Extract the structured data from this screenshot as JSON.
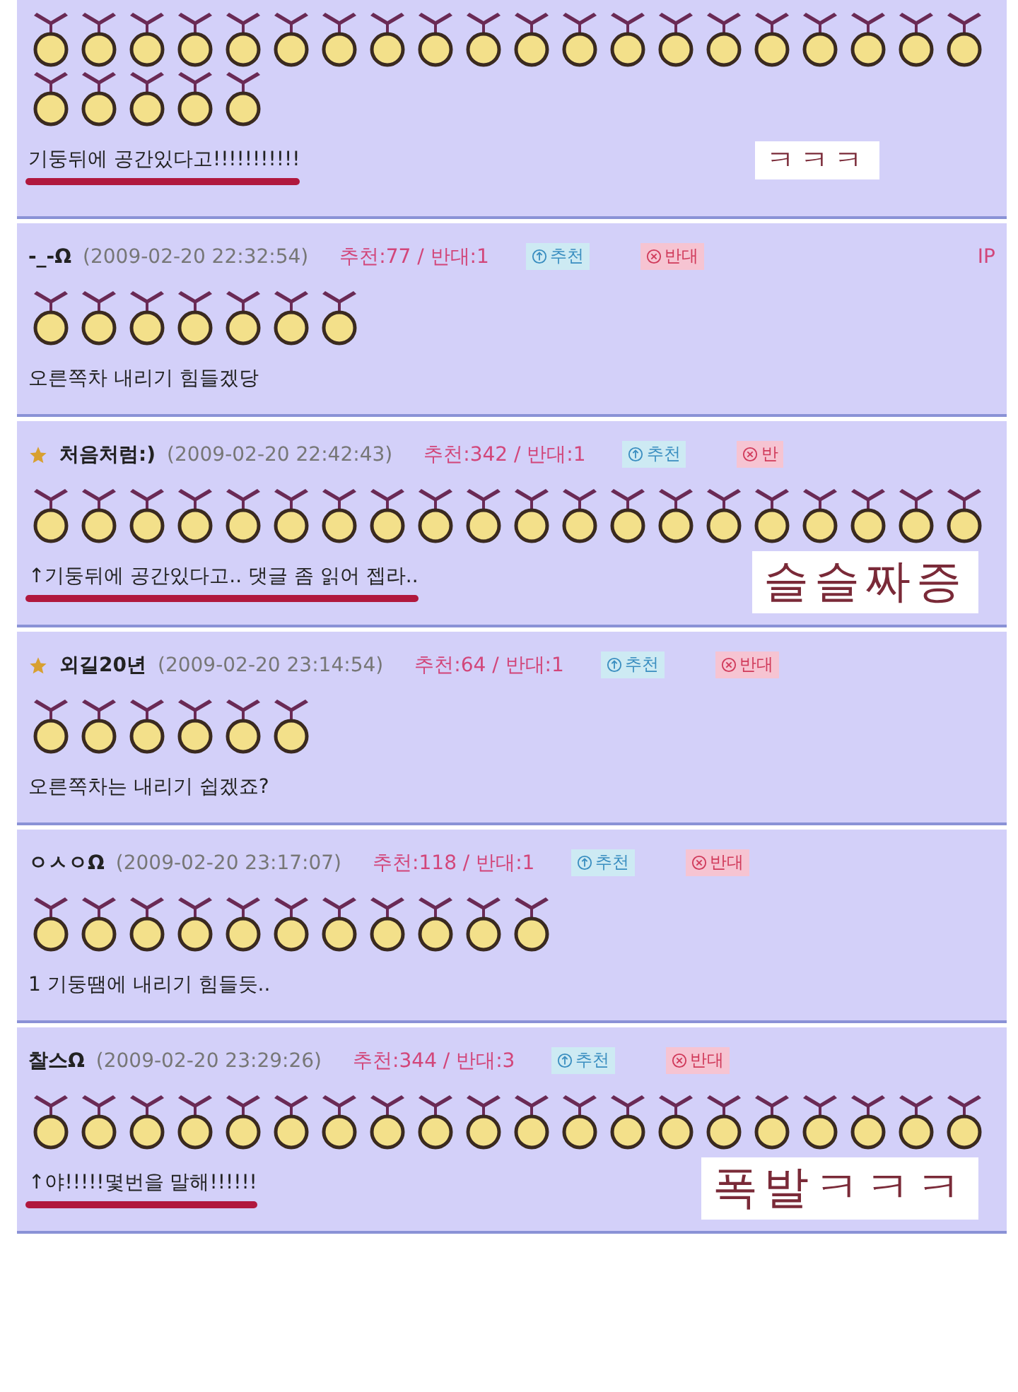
{
  "comments": [
    {
      "medals": [
        {
          "kind": "medal"
        },
        {
          "kind": "medal"
        },
        {
          "kind": "medal"
        },
        {
          "kind": "medal"
        },
        {
          "kind": "medal"
        },
        {
          "kind": "medal"
        },
        {
          "kind": "medal"
        },
        {
          "kind": "medal"
        },
        {
          "kind": "medal"
        },
        {
          "kind": "medal"
        },
        {
          "kind": "medal"
        },
        {
          "kind": "medal"
        },
        {
          "kind": "medal"
        },
        {
          "kind": "medal"
        },
        {
          "kind": "medal"
        },
        {
          "kind": "medal"
        },
        {
          "kind": "medal"
        },
        {
          "kind": "medal"
        },
        {
          "kind": "medal"
        },
        {
          "kind": "medal"
        },
        {
          "kind": "medal"
        },
        {
          "kind": "medal"
        },
        {
          "kind": "medal"
        },
        {
          "kind": "medal"
        },
        {
          "kind": "medal"
        }
      ],
      "text": "기둥뒤에 공간있다고!!!!!!!!!!!",
      "underlined": true,
      "caption": "ㅋㅋㅋ"
    },
    {
      "author": "-_-Ω",
      "starred": false,
      "date": "(2009-02-20 22:32:54)",
      "votes": "추천:77 / 반대:1",
      "buttons": [
        {
          "kind": "recommend",
          "label": "추천"
        },
        {
          "kind": "oppose",
          "label": "반대"
        }
      ],
      "ip": "IP",
      "medals": [
        {
          "kind": "medal"
        },
        {
          "kind": "medal"
        },
        {
          "kind": "medal"
        },
        {
          "kind": "medal"
        },
        {
          "kind": "medal"
        },
        {
          "kind": "medal"
        },
        {
          "kind": "medal"
        }
      ],
      "text": "오른쪽차 내리기 힘들겠당",
      "underlined": false
    },
    {
      "author": "처음처럼:)",
      "starred": true,
      "date": "(2009-02-20 22:42:43)",
      "votes": "추천:342 / 반대:1",
      "buttons": [
        {
          "kind": "recommend",
          "label": "추천"
        },
        {
          "kind": "oppose",
          "label": "반"
        }
      ],
      "medals": [
        {
          "kind": "medal"
        },
        {
          "kind": "medal"
        },
        {
          "kind": "medal"
        },
        {
          "kind": "medal"
        },
        {
          "kind": "medal"
        },
        {
          "kind": "medal"
        },
        {
          "kind": "medal"
        },
        {
          "kind": "medal"
        },
        {
          "kind": "medal"
        },
        {
          "kind": "medal"
        },
        {
          "kind": "medal"
        },
        {
          "kind": "medal"
        },
        {
          "kind": "medal"
        },
        {
          "kind": "medal"
        },
        {
          "kind": "medal"
        },
        {
          "kind": "medal"
        },
        {
          "kind": "medal"
        },
        {
          "kind": "medal"
        },
        {
          "kind": "medal"
        },
        {
          "kind": "medal"
        }
      ],
      "text": "↑기둥뒤에 공간있다고.. 댓글 좀 읽어 젭라..",
      "underlined": true,
      "caption": "슬슬짜증"
    },
    {
      "author": "외길20년",
      "starred": true,
      "date": "(2009-02-20 23:14:54)",
      "votes": "추천:64 / 반대:1",
      "buttons": [
        {
          "kind": "recommend",
          "label": "추천"
        },
        {
          "kind": "oppose",
          "label": "반대"
        }
      ],
      "medals": [
        {
          "kind": "medal"
        },
        {
          "kind": "medal"
        },
        {
          "kind": "medal"
        },
        {
          "kind": "medal"
        },
        {
          "kind": "medal"
        },
        {
          "kind": "medal"
        }
      ],
      "text": "오른쪽차는 내리기 쉽겠죠?",
      "underlined": false
    },
    {
      "author": "ㅇㅅㅇΩ",
      "starred": false,
      "date": "(2009-02-20 23:17:07)",
      "votes": "추천:118 / 반대:1",
      "buttons": [
        {
          "kind": "recommend",
          "label": "추천"
        },
        {
          "kind": "oppose",
          "label": "반대"
        }
      ],
      "medals": [
        {
          "kind": "medal"
        },
        {
          "kind": "medal"
        },
        {
          "kind": "medal"
        },
        {
          "kind": "medal"
        },
        {
          "kind": "medal"
        },
        {
          "kind": "medal"
        },
        {
          "kind": "medal"
        },
        {
          "kind": "medal"
        },
        {
          "kind": "medal"
        },
        {
          "kind": "medal"
        },
        {
          "kind": "medal"
        }
      ],
      "text": "1 기둥땜에 내리기 힘들듯..",
      "underlined": false
    },
    {
      "author": "찰스Ω",
      "starred": false,
      "date": "(2009-02-20 23:29:26)",
      "votes": "추천:344 / 반대:3",
      "buttons": [
        {
          "kind": "recommend",
          "label": "추천"
        },
        {
          "kind": "oppose",
          "label": "반대"
        }
      ],
      "medals": [
        {
          "kind": "medal"
        },
        {
          "kind": "medal"
        },
        {
          "kind": "medal"
        },
        {
          "kind": "medal"
        },
        {
          "kind": "medal"
        },
        {
          "kind": "medal"
        },
        {
          "kind": "medal"
        },
        {
          "kind": "medal"
        },
        {
          "kind": "medal"
        },
        {
          "kind": "medal"
        },
        {
          "kind": "medal"
        },
        {
          "kind": "medal"
        },
        {
          "kind": "medal"
        },
        {
          "kind": "medal"
        },
        {
          "kind": "medal"
        },
        {
          "kind": "medal"
        },
        {
          "kind": "medal"
        },
        {
          "kind": "medal"
        },
        {
          "kind": "medal"
        },
        {
          "kind": "medal"
        }
      ],
      "text": "↑야!!!!!몇번을 말해!!!!!!",
      "underlined": true,
      "caption": "폭발ㅋㅋㅋ"
    }
  ]
}
